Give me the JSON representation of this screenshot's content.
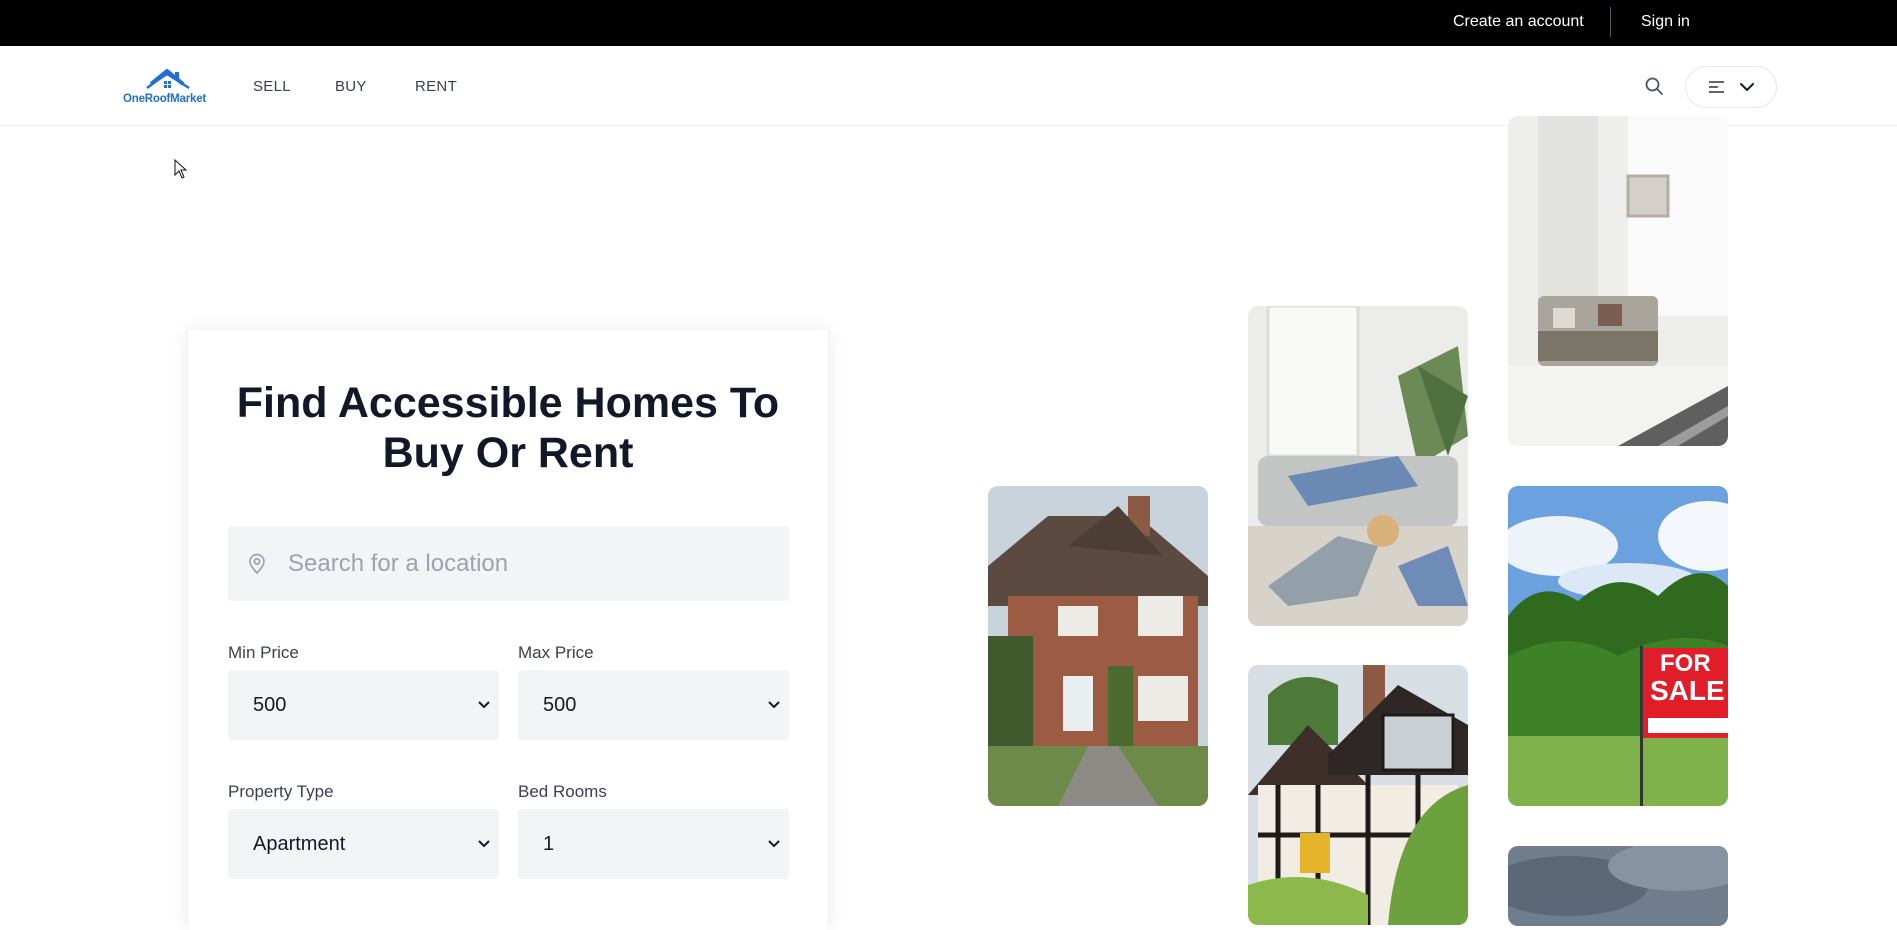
{
  "topbar": {
    "create_account": "Create an account",
    "sign_in": "Sign in"
  },
  "navbar": {
    "logo_text": "OneRoofMarket",
    "items": [
      {
        "label": "SELL"
      },
      {
        "label": "BUY"
      },
      {
        "label": "RENT"
      }
    ],
    "search_icon": "search-icon",
    "menu_icons": [
      "menu-lines-icon",
      "chevron-down-icon"
    ]
  },
  "hero": {
    "title_line1": "Find Accessible Homes To",
    "title_line2": "Buy Or Rent",
    "location_placeholder": "Search for a location",
    "min_price_label": "Min Price",
    "min_price_value": "500",
    "max_price_label": "Max Price",
    "max_price_value": "500",
    "property_type_label": "Property Type",
    "property_type_value": "Apartment",
    "bed_rooms_label": "Bed Rooms",
    "bed_rooms_value": "1"
  },
  "images": [
    {
      "name": "living-room-image"
    },
    {
      "name": "family-room-image"
    },
    {
      "name": "brick-house-image"
    },
    {
      "name": "for-sale-sign-image",
      "sign_text": "FOR SALE"
    },
    {
      "name": "tudor-house-image"
    },
    {
      "name": "sky-image"
    }
  ],
  "colors": {
    "brand": "#1f6fd6",
    "topbar_bg": "#000000",
    "input_bg": "#f3f4f6",
    "sale_red": "#e11d2a"
  }
}
